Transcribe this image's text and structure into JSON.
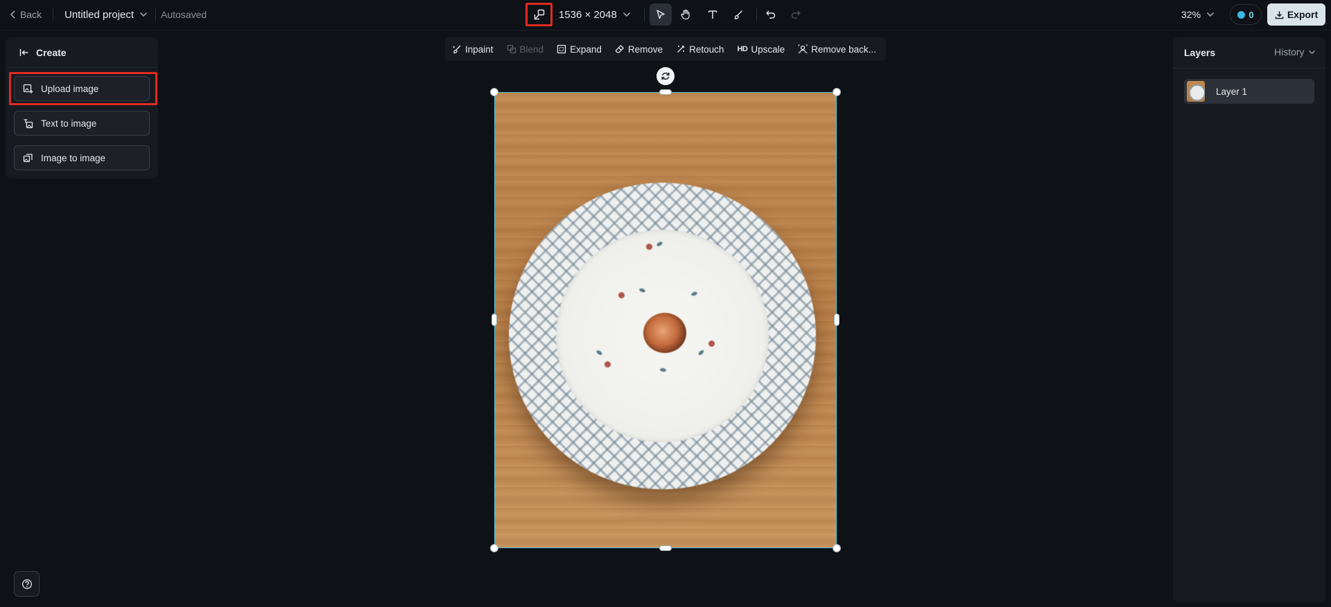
{
  "topbar": {
    "back_label": "Back",
    "project_name": "Untitled project",
    "autosaved_label": "Autosaved",
    "dimensions": "1536 × 2048",
    "zoom": "32%",
    "credits": "0",
    "export_label": "Export"
  },
  "create_panel": {
    "title": "Create",
    "items": [
      {
        "label": "Upload image",
        "icon": "upload-image-icon"
      },
      {
        "label": "Text to image",
        "icon": "text-to-image-icon"
      },
      {
        "label": "Image to image",
        "icon": "image-to-image-icon"
      }
    ]
  },
  "context_toolbar": {
    "items": [
      {
        "label": "Inpaint",
        "icon": "inpaint-icon",
        "enabled": true
      },
      {
        "label": "Blend",
        "icon": "blend-icon",
        "enabled": false
      },
      {
        "label": "Expand",
        "icon": "expand-icon",
        "enabled": true
      },
      {
        "label": "Remove",
        "icon": "eraser-icon",
        "enabled": true
      },
      {
        "label": "Retouch",
        "icon": "retouch-icon",
        "enabled": true
      },
      {
        "label": "Upscale",
        "icon": "hd-icon",
        "badge": "HD",
        "enabled": true
      },
      {
        "label": "Remove back...",
        "icon": "remove-background-icon",
        "enabled": true
      }
    ]
  },
  "layers_panel": {
    "title": "Layers",
    "history_label": "History",
    "layers": [
      {
        "name": "Layer 1"
      }
    ]
  },
  "colors": {
    "highlight": "#e02b20",
    "selection": "#4fc4d8",
    "export_bg": "#d9e4ea",
    "credit_accent": "#38b8e0"
  }
}
